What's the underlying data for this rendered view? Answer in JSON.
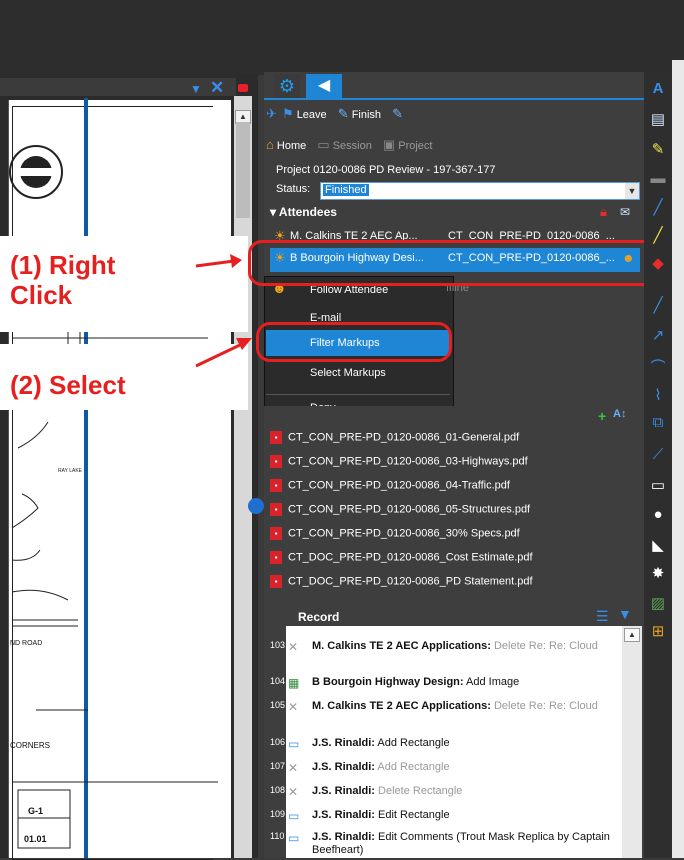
{
  "viewer": {
    "sheet_labels": {
      "corners": "CORNERS",
      "road": "ND ROAD",
      "sheet_id": "G-1",
      "sheet_num": "01.01"
    }
  },
  "panel": {
    "tabs": [
      {
        "name": "settings-tab",
        "icon": "gear-icon"
      },
      {
        "name": "studio-session-tab",
        "icon": "megaphone-icon"
      }
    ],
    "toolbar1": {
      "leave": "Leave",
      "finish": "Finish"
    },
    "toolbar2": {
      "home": "Home",
      "session": "Session",
      "project": "Project"
    },
    "project_name": "Project 0120-0086 PD Review - 197-367-177",
    "status_label": "Status:",
    "status_value": "Finished",
    "attendees_header": "Attendees",
    "attendees": [
      {
        "name": "M. Calkins TE 2 AEC Ap...",
        "file": "CT_CON_PRE-PD_0120-0086_..."
      },
      {
        "name": "B Bourgoin Highway Desi...",
        "file": "CT_CON_PRE-PD_0120-0086_..."
      }
    ],
    "offline_fragment": "ffline"
  },
  "context_menu": {
    "items": [
      "Follow Attendee",
      "E-mail",
      "Filter Markups",
      "Select Markups",
      "Deny"
    ]
  },
  "annotations": {
    "step1_line1": "(1) Right",
    "step1_line2": "Click",
    "step2": "(2) Select"
  },
  "files": [
    "CT_CON_PRE-PD_0120-0086_01-General.pdf",
    "CT_CON_PRE-PD_0120-0086_03-Highways.pdf",
    "CT_CON_PRE-PD_0120-0086_04-Traffic.pdf",
    "CT_CON_PRE-PD_0120-0086_05-Structures.pdf",
    "CT_CON_PRE-PD_0120-0086_30% Specs.pdf",
    "CT_DOC_PRE-PD_0120-0086_Cost Estimate.pdf",
    "CT_DOC_PRE-PD_0120-0086_PD Statement.pdf"
  ],
  "record": {
    "title": "Record",
    "entries": [
      {
        "num": "103",
        "user": "M. Calkins TE 2 AEC Applications:",
        "action": "Delete Re: Re: Cloud",
        "dim": true,
        "icon": "x-icon"
      },
      {
        "num": "104",
        "user": "B Bourgoin Highway Design:",
        "action": "Add Image",
        "dim": false,
        "icon": "image-icon"
      },
      {
        "num": "105",
        "user": "M. Calkins TE 2 AEC Applications:",
        "action": "Delete Re: Re: Cloud",
        "dim": true,
        "icon": "x-icon"
      },
      {
        "num": "106",
        "user": "J.S. Rinaldi:",
        "action": "Add Rectangle",
        "dim": false,
        "icon": "rectangle-icon"
      },
      {
        "num": "107",
        "user": "J.S. Rinaldi:",
        "action": "Add Rectangle",
        "dim": true,
        "icon": "x-icon"
      },
      {
        "num": "108",
        "user": "J.S. Rinaldi:",
        "action": "Delete Rectangle",
        "dim": true,
        "icon": "x-icon"
      },
      {
        "num": "109",
        "user": "J.S. Rinaldi:",
        "action": "Edit Rectangle",
        "dim": false,
        "icon": "rectangle-icon"
      },
      {
        "num": "110",
        "user": "J.S. Rinaldi:",
        "action": "Edit Comments (Trout Mask Replica by Captain Beefheart)",
        "dim": false,
        "icon": "rectangle-icon"
      }
    ]
  },
  "colors": {
    "accent": "#1f86d6",
    "annotation_red": "#e61f1f",
    "pdf_red": "#d8232a"
  }
}
